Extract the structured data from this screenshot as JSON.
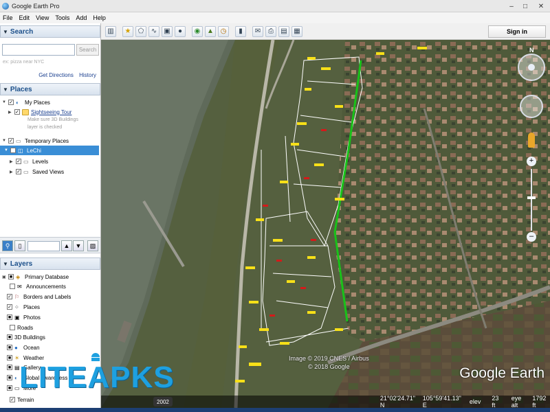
{
  "window": {
    "title": "Google Earth Pro",
    "controls": [
      "–",
      "□",
      "✕"
    ]
  },
  "menu": [
    "File",
    "Edit",
    "View",
    "Tools",
    "Add",
    "Help"
  ],
  "toolbar": {
    "buttons": [
      "sidebar",
      "placemark",
      "polygon",
      "path",
      "overlay",
      "tour",
      "planets",
      "sun",
      "historical",
      "ruler",
      "email",
      "print",
      "save-image",
      "view-in-maps"
    ],
    "signin_label": "Sign in"
  },
  "search": {
    "header": "Search",
    "input_value": "",
    "button_label": "Search",
    "hint": "ex: pizza near NYC",
    "get_directions": "Get Directions",
    "history": "History"
  },
  "places": {
    "header": "Places",
    "my_places": "My Places",
    "sightseeing": "Sightseeing Tour",
    "note_line1": "Make sure 3D Buildings",
    "note_line2": "layer is checked",
    "temporary": "Temporary Places",
    "lechi": "LeChi",
    "levels": "Levels",
    "saved_views": "Saved Views"
  },
  "layers": {
    "header": "Layers",
    "items": [
      "Primary Database",
      "Announcements",
      "Borders and Labels",
      "Places",
      "Photos",
      "Roads",
      "3D Buildings",
      "Ocean",
      "Weather",
      "Gallery",
      "Global Awareness",
      "More",
      "Terrain"
    ]
  },
  "map": {
    "copyright_line1": "Image © 2019 CNES / Airbus",
    "copyright_line2": "© 2018 Google",
    "brand": "Google Earth",
    "year_badge": "2002",
    "coords": "21°02'24.71\" N",
    "lon": "105°59'41.13\" E",
    "elev_label": "elev",
    "elev_value": "23 ft",
    "eyealt_label": "eye alt",
    "eyealt_value": "1792 ft"
  },
  "watermark": "LITEAPKS"
}
